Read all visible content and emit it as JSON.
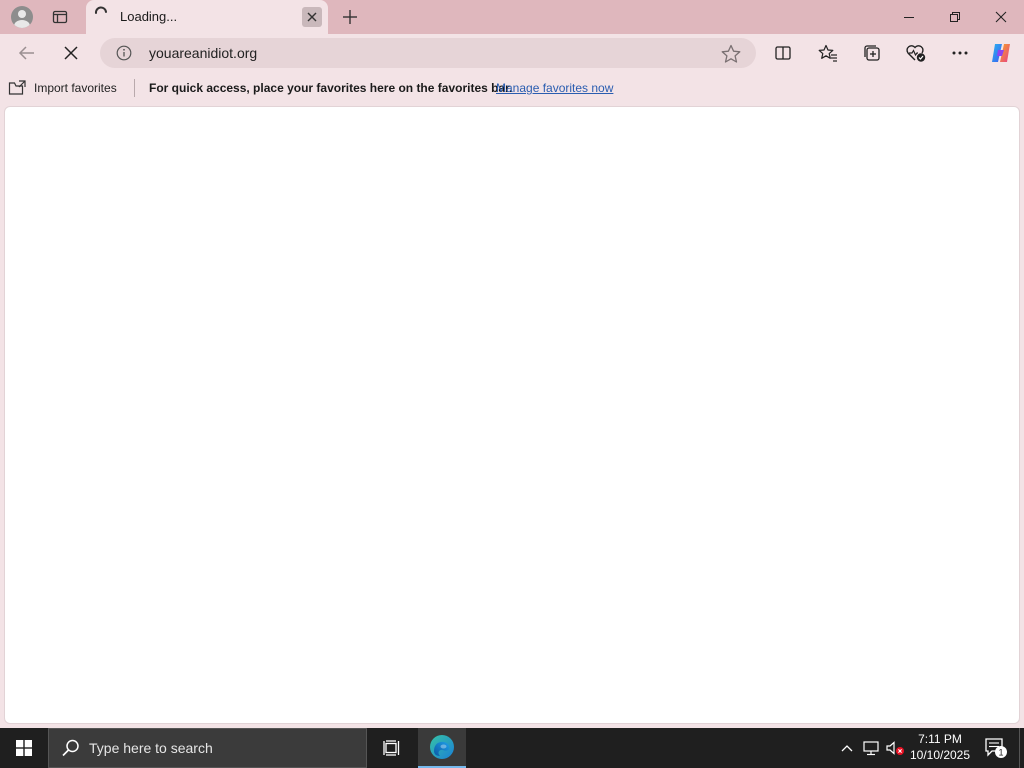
{
  "tab": {
    "title": "Loading...",
    "status": "loading"
  },
  "addressbar": {
    "url": "youareanidiot.org"
  },
  "favorites_bar": {
    "import_label": "Import favorites",
    "message": "For quick access, place your favorites here on the favorites bar.",
    "manage_link": "Manage favorites now"
  },
  "taskbar": {
    "search_placeholder": "Type here to search",
    "time": "7:11 PM",
    "date": "10/10/2025",
    "notification_count": "1"
  },
  "icons": {
    "profile": "profile-icon",
    "tab_actions": "tab-actions-icon",
    "spinner": "loading-spinner-icon",
    "close_tab": "close-icon",
    "new_tab": "plus-icon",
    "minimize": "minimize-icon",
    "restore": "restore-icon",
    "close_window": "close-icon",
    "back": "back-arrow-icon",
    "stop": "stop-icon",
    "info": "info-icon",
    "favorite_star": "star-icon",
    "split_screen": "split-screen-icon",
    "favorites": "favorites-icon",
    "collections": "collections-icon",
    "performance": "performance-icon",
    "more": "more-icon",
    "copilot": "copilot-icon",
    "windows_start": "windows-logo-icon",
    "search": "search-icon",
    "task_view": "task-view-icon",
    "edge": "edge-icon",
    "tray_chevron": "chevron-up-icon",
    "network": "network-icon",
    "volume_muted": "volume-muted-icon",
    "notifications": "notification-icon"
  },
  "colors": {
    "titlebar": "#dfb7bd",
    "toolbar": "#f3e3e6",
    "link": "#2a5db0",
    "taskbar": "#1f1f1f",
    "taskbar_accent": "#76b9ed"
  }
}
